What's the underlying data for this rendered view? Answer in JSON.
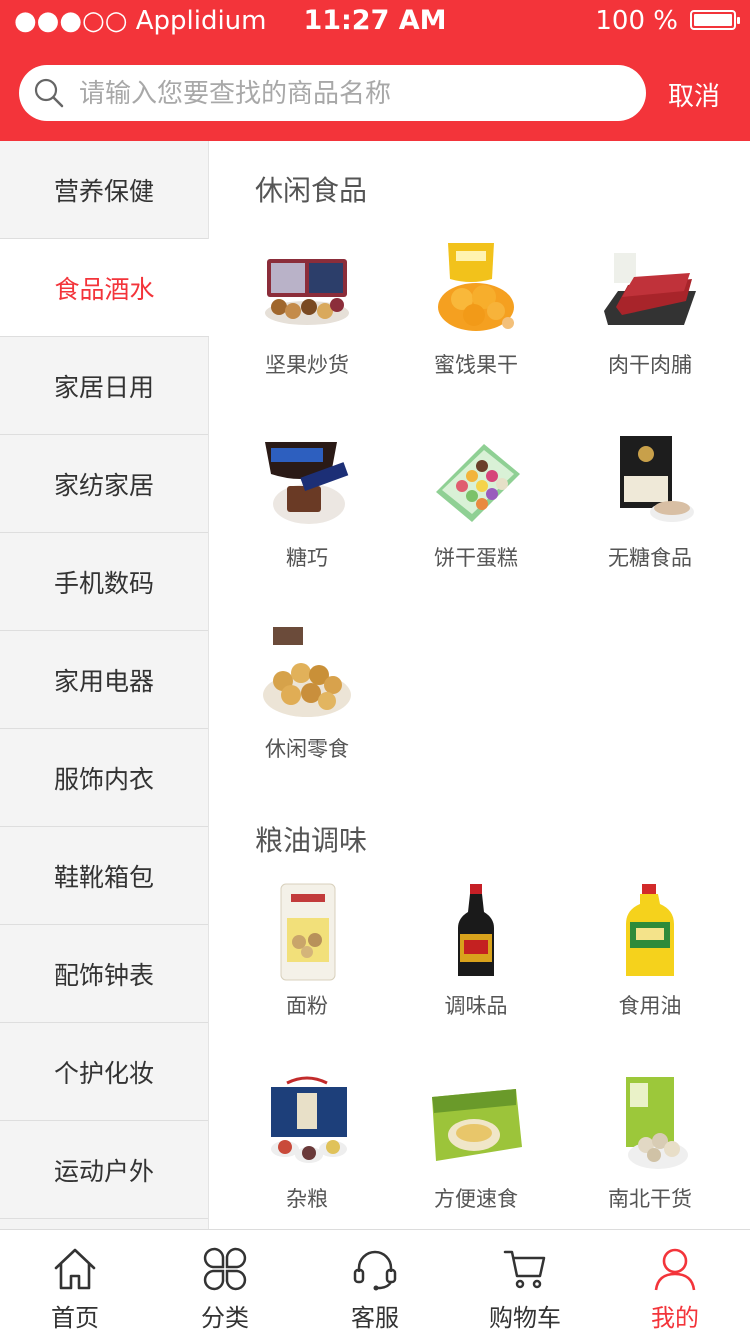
{
  "status_bar": {
    "carrier": "●●●○○ Applidium",
    "time": "11:27 AM",
    "battery": "100 %"
  },
  "search": {
    "placeholder": "请输入您要查找的商品名称",
    "cancel_label": "取消"
  },
  "sidebar": {
    "items": [
      {
        "label": "营养保健",
        "active": false
      },
      {
        "label": "食品酒水",
        "active": true
      },
      {
        "label": "家居日用",
        "active": false
      },
      {
        "label": "家纺家居",
        "active": false
      },
      {
        "label": "手机数码",
        "active": false
      },
      {
        "label": "家用电器",
        "active": false
      },
      {
        "label": "服饰内衣",
        "active": false
      },
      {
        "label": "鞋靴箱包",
        "active": false
      },
      {
        "label": "配饰钟表",
        "active": false
      },
      {
        "label": "个护化妆",
        "active": false
      },
      {
        "label": "运动户外",
        "active": false
      }
    ]
  },
  "sections": [
    {
      "title": "休闲食品",
      "products": [
        {
          "label": "坚果炒货",
          "icon": "nuts-gift-box-image"
        },
        {
          "label": "蜜饯果干",
          "icon": "dried-mango-image"
        },
        {
          "label": "肉干肉脯",
          "icon": "beef-jerky-image"
        },
        {
          "label": "糖巧",
          "icon": "chocolate-bar-image"
        },
        {
          "label": "饼干蛋糕",
          "icon": "macaron-box-image"
        },
        {
          "label": "无糖食品",
          "icon": "oat-box-image"
        },
        {
          "label": "休闲零食",
          "icon": "rice-cracker-image"
        }
      ]
    },
    {
      "title": "粮油调味",
      "products": [
        {
          "label": "面粉",
          "icon": "flour-bag-image"
        },
        {
          "label": "调味品",
          "icon": "soy-sauce-bottle-image"
        },
        {
          "label": "食用油",
          "icon": "cooking-oil-bottle-image"
        },
        {
          "label": "杂粮",
          "icon": "grain-gift-box-image"
        },
        {
          "label": "方便速食",
          "icon": "instant-noodles-image"
        },
        {
          "label": "南北干货",
          "icon": "dried-mushroom-image"
        }
      ]
    }
  ],
  "tabbar": {
    "tabs": [
      {
        "label": "首页",
        "icon": "home-icon",
        "active": false
      },
      {
        "label": "分类",
        "icon": "category-icon",
        "active": false
      },
      {
        "label": "客服",
        "icon": "headset-icon",
        "active": false
      },
      {
        "label": "购物车",
        "icon": "cart-icon",
        "active": false
      },
      {
        "label": "我的",
        "icon": "user-icon",
        "active": true
      }
    ]
  },
  "colors": {
    "accent": "#f3343a",
    "sidebar_bg": "#f4f4f4",
    "text": "#333333"
  }
}
